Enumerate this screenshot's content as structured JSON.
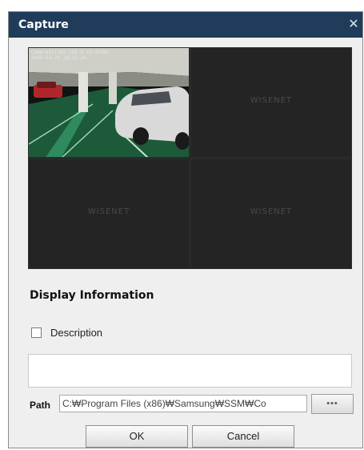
{
  "dialog": {
    "title": "Capture",
    "close_glyph": "✕",
    "preview": {
      "camera_osd": "Camera01(192.168.0.43:4520)\n2015-03-25 18:35:24",
      "watermark": "WISENET"
    },
    "display_information": {
      "heading": "Display Information",
      "description_label": "Description",
      "description_checked": false,
      "description_text": ""
    },
    "path": {
      "label": "Path",
      "value": "C:₩Program Files (x86)₩Samsung₩SSM₩Co",
      "browse_label": "•••"
    },
    "buttons": {
      "ok": "OK",
      "cancel": "Cancel"
    }
  }
}
